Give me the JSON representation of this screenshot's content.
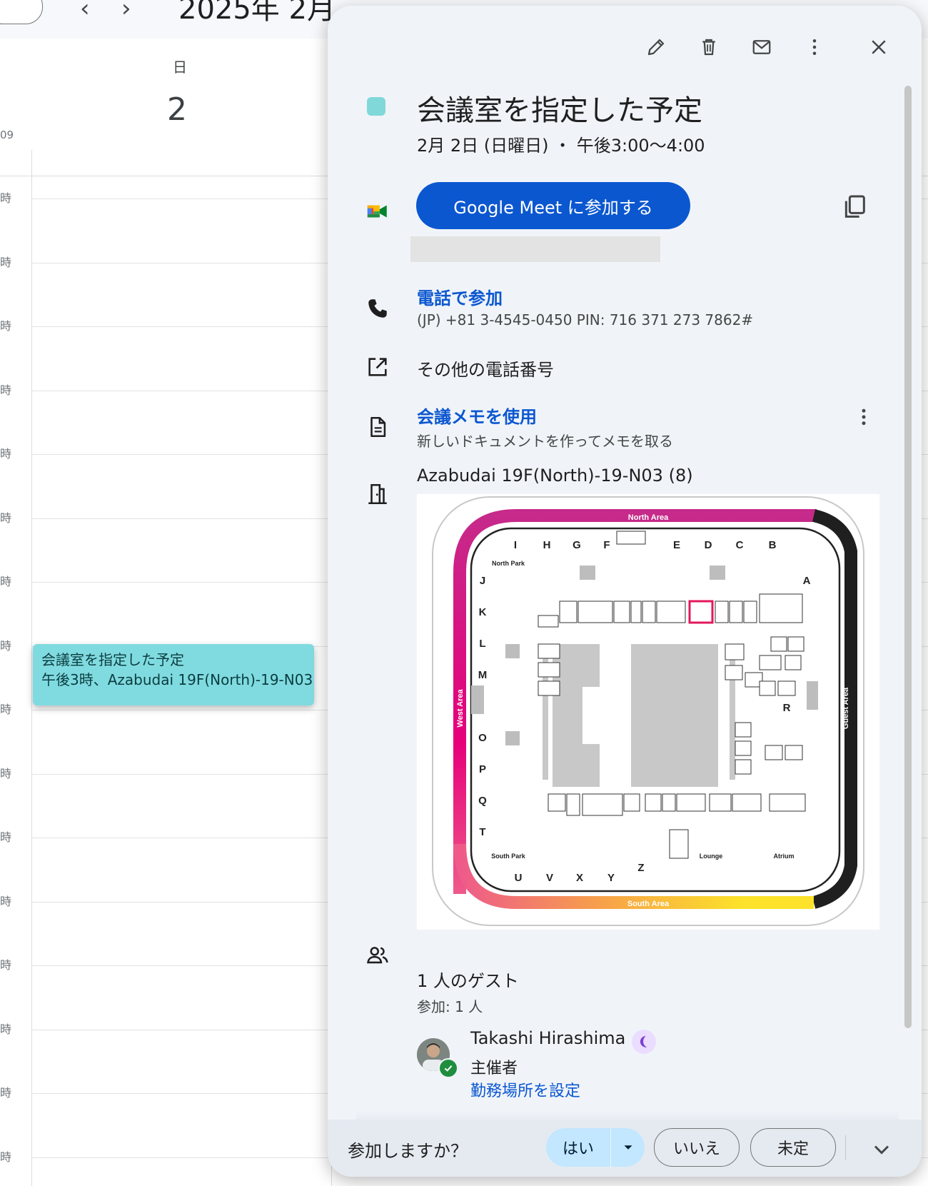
{
  "calendar": {
    "month_title": "2025年 2月",
    "weekday": "日",
    "day_number": "2",
    "timezone_label": "09",
    "hour_label": "時",
    "event_chip": {
      "title": "会議室を指定した予定",
      "subtitle": "午後3時、Azabudai 19F(North)-19-N03"
    }
  },
  "popup": {
    "title": "会議室を指定した予定",
    "datetime": "2月 2日 (日曜日) ・ 午後3:00～4:00",
    "event_color": "#80d8d8",
    "toolbar_icons": [
      "edit-icon",
      "delete-icon",
      "email-icon",
      "more-vert-icon",
      "close-icon"
    ],
    "meet": {
      "button_label": "Google Meet に参加する"
    },
    "phone": {
      "link_label": "電話で参加",
      "number": "(JP) +81 3-4545-0450 PIN: 716 371 273 7862#"
    },
    "other_numbers": "その他の電話番号",
    "notes": {
      "link_label": "会議メモを使用",
      "description": "新しいドキュメントを作ってメモを取る"
    },
    "room": {
      "name": "Azabudai 19F(North)-19-N03 (8)",
      "map": {
        "north": "North Area",
        "south": "South Area",
        "west": "West Area",
        "east": "Guest Area",
        "north_park": "North Park",
        "south_park": "South Park",
        "lounge": "Lounge",
        "atrium": "Atrium",
        "top_letters": [
          "I",
          "H",
          "G",
          "F",
          "E",
          "D",
          "C",
          "B"
        ],
        "left_letters": [
          "J",
          "K",
          "L",
          "M",
          "O",
          "P",
          "Q",
          "T"
        ],
        "bottom_letters": [
          "U",
          "V",
          "X",
          "Y",
          "Z"
        ],
        "right_letters": [
          "A",
          "R"
        ]
      }
    },
    "guests": {
      "count_label": "1 人のゲスト",
      "accepted_label": "参加: 1 人",
      "list": [
        {
          "name": "Takashi Hirashima",
          "role": "主催者",
          "action_link": "勤務場所を設定"
        }
      ]
    },
    "rsvp": {
      "question": "参加しますか？",
      "yes": "はい",
      "no": "いいえ",
      "maybe": "未定"
    }
  }
}
